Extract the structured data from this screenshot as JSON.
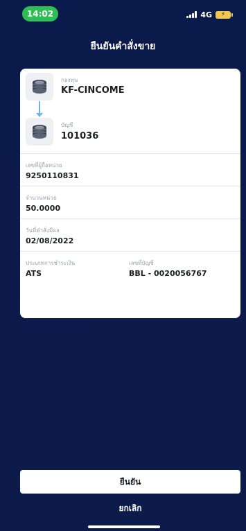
{
  "status_bar": {
    "time": "14:02",
    "network": "4G"
  },
  "header": {
    "title": "ยืนยันคำสั่งขาย"
  },
  "fund": {
    "fund_label": "กองทุน",
    "fund_name": "KF-CINCOME",
    "account_label": "บัญชี",
    "account_number": "101036"
  },
  "details": {
    "holder_label": "เลขที่ผู้ถือหน่วย",
    "holder_value": "9250110831",
    "units_label": "จำนวนหน่วย",
    "units_value": "50.0000",
    "date_label": "วันที่คำสั่งมีผล",
    "date_value": "02/08/2022",
    "payment_type_label": "ประเภทการชำระเงิน",
    "payment_type_value": "ATS",
    "account_no_label": "เลขที่บัญชี",
    "account_no_value": "BBL - 0020056767"
  },
  "actions": {
    "confirm_label": "ยืนยัน",
    "cancel_label": "ยกเลิก"
  },
  "colors": {
    "background": "#0c1b4a",
    "time_pill": "#2dbf53",
    "connector": "#6bb3e9",
    "battery": "#f2c94c"
  }
}
